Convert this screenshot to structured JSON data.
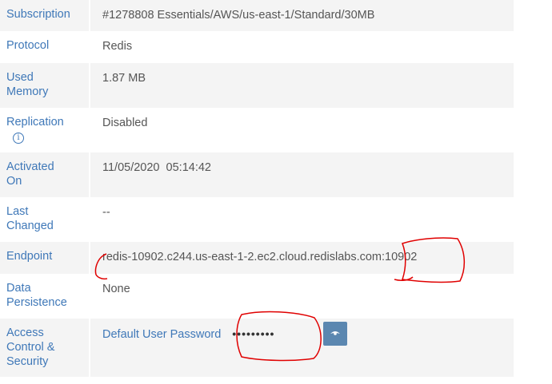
{
  "rows": [
    {
      "label": "Subscription",
      "value": "#1278808 Essentials/AWS/us-east-1/Standard/30MB"
    },
    {
      "label": "Protocol",
      "value": "Redis"
    },
    {
      "label": "Used Memory",
      "value": "1.87 MB"
    },
    {
      "label": "Replication",
      "value": "Disabled"
    },
    {
      "label": "Activated On",
      "value": "11/05/2020  05:14:42"
    },
    {
      "label": "Last Changed",
      "value": "--"
    },
    {
      "label": "Endpoint",
      "value": "redis-10902.c244.us-east-1-2.ec2.cloud.redislabs.com:10902"
    },
    {
      "label": "Data Persistence",
      "value": "None"
    },
    {
      "label": "Access Control & Security",
      "password_label": "Default User Password",
      "password_mask": "•••••••••"
    }
  ],
  "icons": {
    "info": "info-circle-icon",
    "reveal": "eye-icon"
  },
  "colors": {
    "label": "#3f78b8",
    "value": "#555555",
    "row_alt": "#f4f4f4",
    "button": "#5b87b0",
    "annotation": "#e00000"
  }
}
